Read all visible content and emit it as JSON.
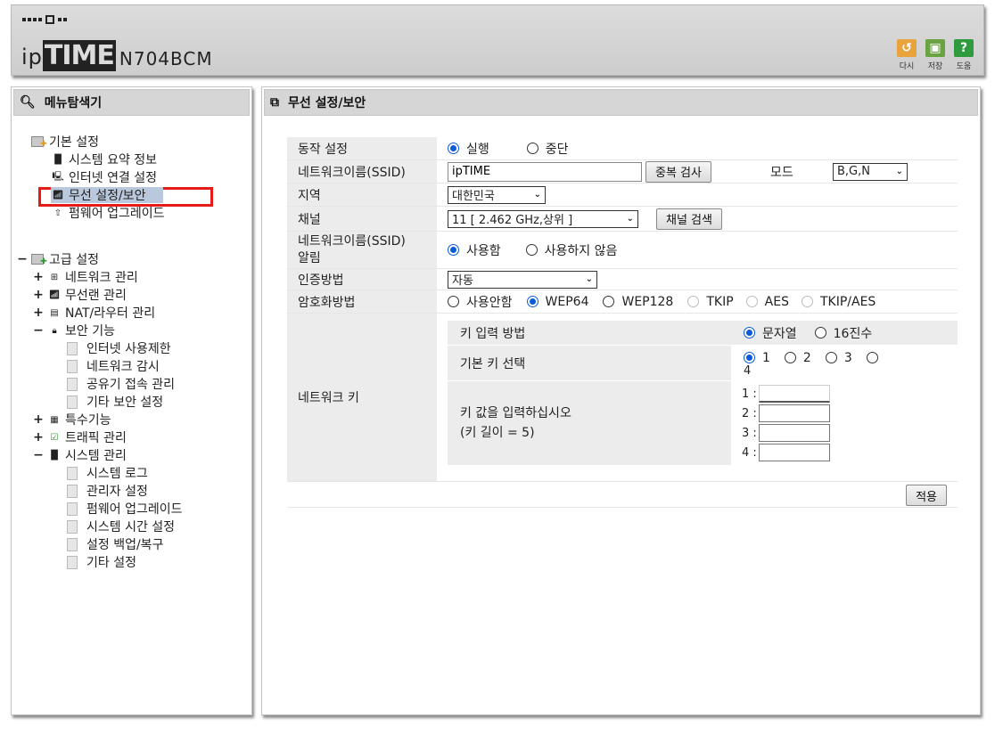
{
  "header": {
    "brand_ip": "ip",
    "brand_time": "TIME",
    "model": "N704BCM",
    "tools": [
      {
        "label": "다시",
        "icon": "refresh-icon",
        "color": "#e8a33d",
        "glyph": "↺"
      },
      {
        "label": "저장",
        "icon": "save-icon",
        "color": "#6aa343",
        "glyph": "▣"
      },
      {
        "label": "도움",
        "icon": "help-icon",
        "color": "#2e9b3f",
        "glyph": "?"
      }
    ]
  },
  "left": {
    "title": "메뉴탐색기",
    "basic": {
      "label": "기본 설정",
      "items": [
        "시스템 요약 정보",
        "인터넷 연결 설정",
        "무선 설정/보안",
        "펌웨어 업그레이드"
      ]
    },
    "advanced": {
      "label": "고급 설정",
      "items": [
        {
          "label": "네트워크 관리",
          "expand": "+"
        },
        {
          "label": "무선랜 관리",
          "expand": "+"
        },
        {
          "label": "NAT/라우터 관리",
          "expand": "+"
        },
        {
          "label": "보안 기능",
          "expand": "−"
        },
        {
          "label": "특수기능",
          "expand": "+"
        },
        {
          "label": "트래픽 관리",
          "expand": "+"
        },
        {
          "label": "시스템 관리",
          "expand": "−"
        }
      ],
      "security_items": [
        "인터넷 사용제한",
        "네트워크 감시",
        "공유기 접속 관리",
        "기타 보안 설정"
      ],
      "system_items": [
        "시스템 로그",
        "관리자 설정",
        "펌웨어 업그레이드",
        "시스템 시간 설정",
        "설정 백업/복구",
        "기타 설정"
      ]
    },
    "selected": "무선 설정/보안"
  },
  "main": {
    "title": "무선 설정/보안",
    "operation": {
      "label": "동작 설정",
      "options": [
        "실행",
        "중단"
      ],
      "selected": "실행"
    },
    "ssid": {
      "label": "네트워크이름(SSID)",
      "value": "ipTIME",
      "check_button": "중복 검사",
      "mode_label": "모드",
      "mode_value": "B,G,N"
    },
    "region": {
      "label": "지역",
      "value": "대한민국"
    },
    "channel": {
      "label": "채널",
      "value": "11 [ 2.462 GHz,상위 ]",
      "search_button": "채널 검색"
    },
    "ssid_broadcast": {
      "label_line1": "네트워크이름(SSID)",
      "label_line2": "알림",
      "options": [
        "사용함",
        "사용하지 않음"
      ],
      "selected": "사용함"
    },
    "auth": {
      "label": "인증방법",
      "value": "자동"
    },
    "encryption": {
      "label": "암호화방법",
      "options": [
        "사용안함",
        "WEP64",
        "WEP128",
        "TKIP",
        "AES",
        "TKIP/AES"
      ],
      "selected": "WEP64"
    },
    "network_key": {
      "label": "네트워크 키",
      "input_method_label": "키 입력 방법",
      "input_method_options": [
        "문자열",
        "16진수"
      ],
      "input_method_selected": "문자열",
      "default_key_label": "기본 키 선택",
      "default_key_options": [
        "1",
        "2",
        "3",
        "4"
      ],
      "default_key_selected": "1",
      "key_value_label": "키 값을 입력하십시오",
      "key_length_note": "(키 길이 = 5)",
      "key_labels": [
        "1 :",
        "2 :",
        "3 :",
        "4 :"
      ]
    },
    "apply_button": "적용"
  }
}
